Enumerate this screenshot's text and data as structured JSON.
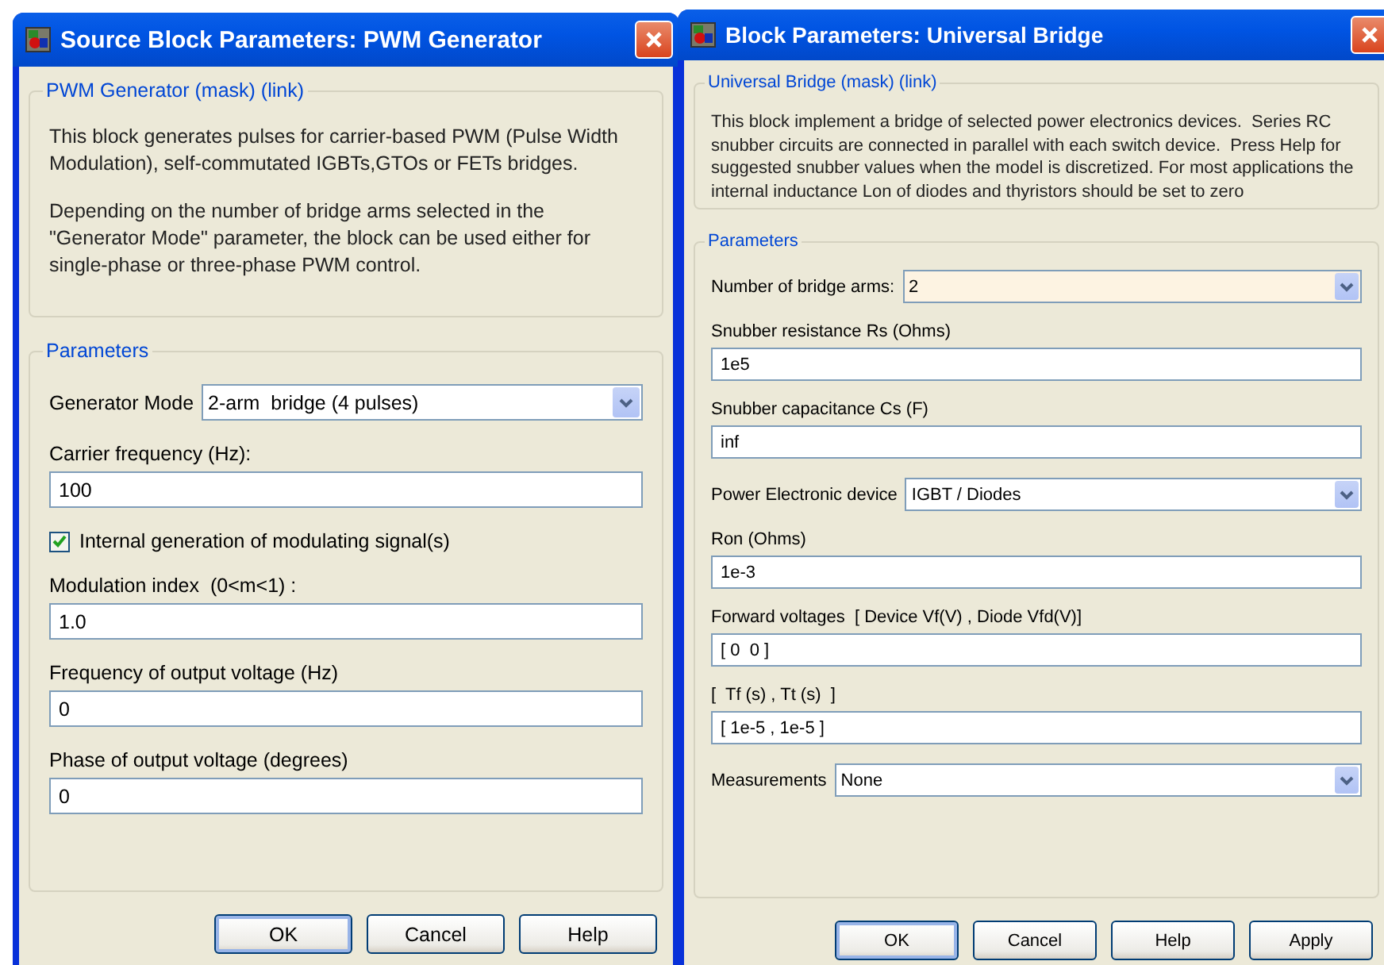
{
  "dialogs": [
    {
      "title": "Source Block Parameters: PWM Generator",
      "description": {
        "heading": "PWM Generator (mask) (link)",
        "paragraphs": [
          "This block generates pulses for carrier-based PWM (Pulse Width Modulation), self-commutated IGBTs,GTOs or FETs bridges.",
          "Depending on the number of bridge arms selected in the \"Generator Mode\" parameter, the block can be used either for single-phase or three-phase PWM control."
        ]
      },
      "parameters": {
        "heading": "Parameters",
        "items": [
          {
            "kind": "dropdown",
            "label": "Generator Mode",
            "value": "2-arm  bridge (4 pulses)",
            "highlighted": false
          },
          {
            "kind": "text",
            "label": "Carrier frequency (Hz):",
            "value": "100"
          },
          {
            "kind": "checkbox",
            "label": "Internal generation of modulating signal(s)",
            "checked": true
          },
          {
            "kind": "text",
            "label": "Modulation index  (0<m<1) :",
            "value": "1.0"
          },
          {
            "kind": "text",
            "label": "Frequency of output voltage (Hz)",
            "value": "0"
          },
          {
            "kind": "text",
            "label": "Phase of output voltage (degrees)",
            "value": "0"
          }
        ]
      },
      "buttons": [
        {
          "label": "OK",
          "default": true
        },
        {
          "label": "Cancel",
          "default": false
        },
        {
          "label": "Help",
          "default": false
        }
      ]
    },
    {
      "title": "Block Parameters: Universal Bridge",
      "description": {
        "heading": "Universal Bridge (mask) (link)",
        "paragraphs": [
          "This block implement a bridge of selected power electronics devices.  Series RC snubber circuits are connected in parallel with each switch device.  Press Help for suggested snubber values when the model is discretized. For most applications the internal inductance Lon of diodes and thyristors should be set to zero"
        ]
      },
      "parameters": {
        "heading": "Parameters",
        "items": [
          {
            "kind": "dropdown",
            "label": "Number of bridge arms:",
            "value": "2",
            "highlighted": true
          },
          {
            "kind": "text",
            "label": "Snubber resistance Rs (Ohms)",
            "value": "1e5"
          },
          {
            "kind": "text",
            "label": "Snubber capacitance Cs (F)",
            "value": "inf"
          },
          {
            "kind": "dropdown",
            "label": "Power Electronic device",
            "value": "IGBT / Diodes",
            "highlighted": false
          },
          {
            "kind": "text",
            "label": "Ron (Ohms)",
            "value": "1e-3"
          },
          {
            "kind": "text",
            "label": "Forward voltages  [ Device Vf(V) , Diode Vfd(V)]",
            "value": "[ 0  0 ]"
          },
          {
            "kind": "text",
            "label": "[  Tf (s) , Tt (s)  ]",
            "value": "[ 1e-5 , 1e-5 ]"
          },
          {
            "kind": "dropdown",
            "label": "Measurements",
            "value": "None",
            "highlighted": false
          }
        ]
      },
      "buttons": [
        {
          "label": "OK",
          "default": true
        },
        {
          "label": "Cancel",
          "default": false
        },
        {
          "label": "Help",
          "default": false
        },
        {
          "label": "Apply",
          "default": false
        }
      ]
    }
  ]
}
